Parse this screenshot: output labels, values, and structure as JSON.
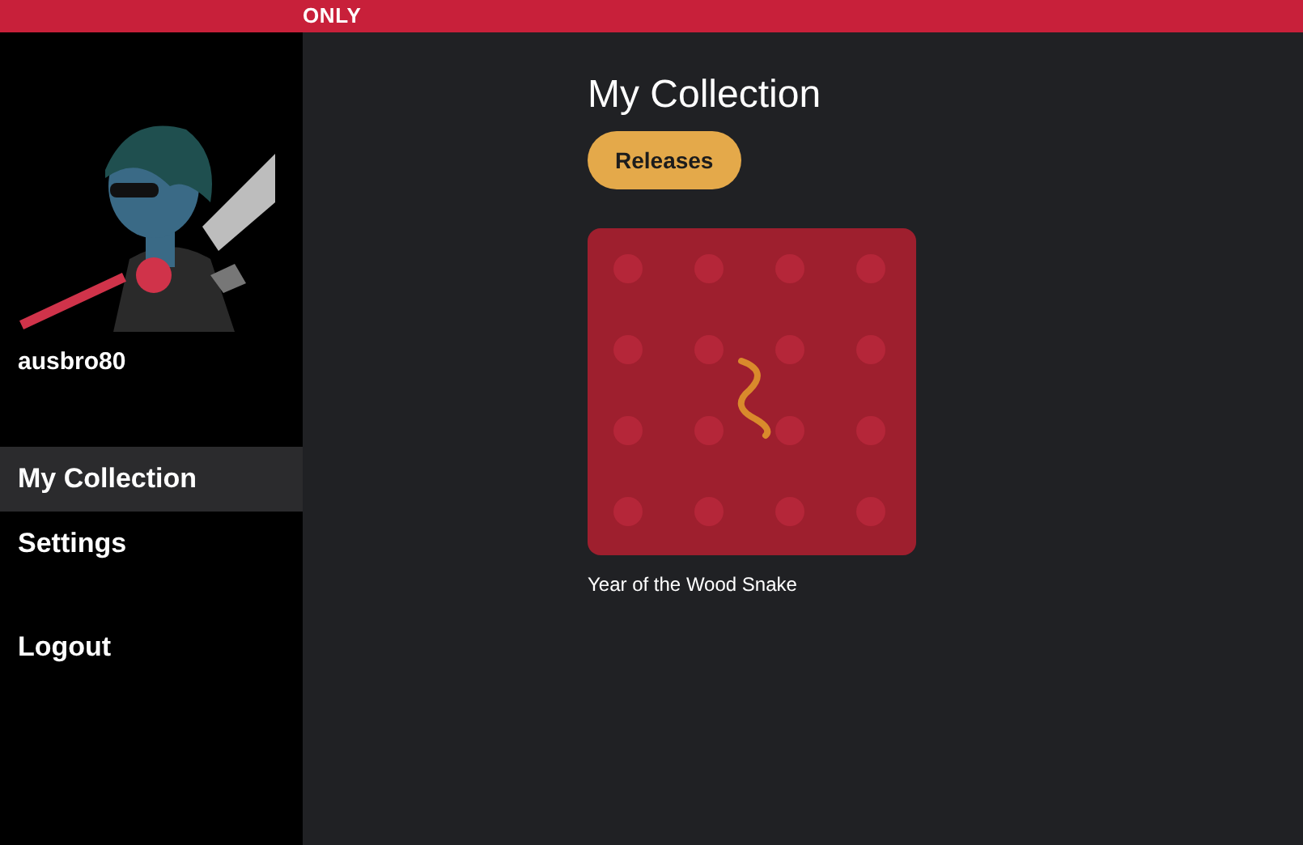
{
  "top_bar": {
    "logo": "ONLY"
  },
  "sidebar": {
    "username": "ausbro80",
    "nav": [
      {
        "label": "My Collection",
        "selected": true
      },
      {
        "label": "Settings",
        "selected": false
      }
    ],
    "logout": "Logout"
  },
  "main": {
    "title": "My Collection",
    "filters": [
      {
        "label": "Releases",
        "selected": true
      }
    ],
    "items": [
      {
        "kind": "picture",
        "caption": "Year of the Wood Snake"
      }
    ]
  }
}
